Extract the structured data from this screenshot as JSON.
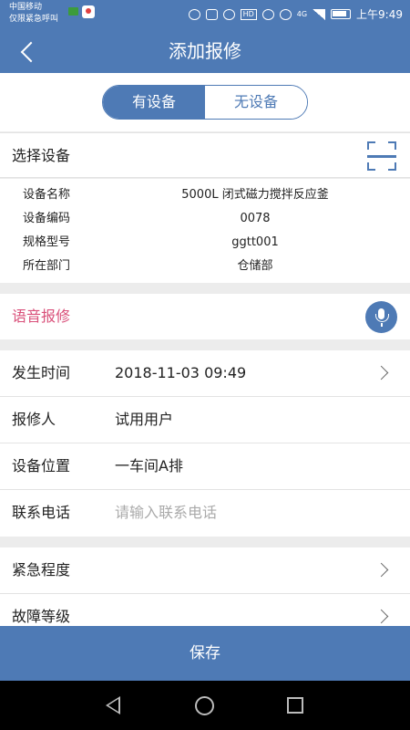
{
  "status_bar": {
    "carrier_line1": "中国移动",
    "carrier_line2": "仅限紧急呼叫",
    "signal_label": "4G",
    "hd_label": "HD",
    "time": "上午9:49"
  },
  "header": {
    "title": "添加报修"
  },
  "segment": {
    "with_device": "有设备",
    "without_device": "无设备",
    "selected": "有设备"
  },
  "select_device": {
    "label": "选择设备"
  },
  "device_info": [
    {
      "label": "设备名称",
      "value": "5000L 闭式磁力搅拌反应釜"
    },
    {
      "label": "设备编码",
      "value": "0078"
    },
    {
      "label": "规格型号",
      "value": "ggtt001"
    },
    {
      "label": "所在部门",
      "value": "仓储部"
    }
  ],
  "voice": {
    "label": "语音报修"
  },
  "form": {
    "occur_time": {
      "label": "发生时间",
      "value": "2018-11-03 09:49"
    },
    "reporter": {
      "label": "报修人",
      "value": "试用用户"
    },
    "location": {
      "label": "设备位置",
      "value": "一车间A排"
    },
    "phone": {
      "label": "联系电话",
      "placeholder": "请输入联系电话"
    },
    "urgency": {
      "label": "紧急程度"
    },
    "fault_level": {
      "label": "故障等级"
    }
  },
  "save": {
    "label": "保存"
  },
  "colors": {
    "primary": "#4e7ab5",
    "voice_label": "#d9507a"
  }
}
